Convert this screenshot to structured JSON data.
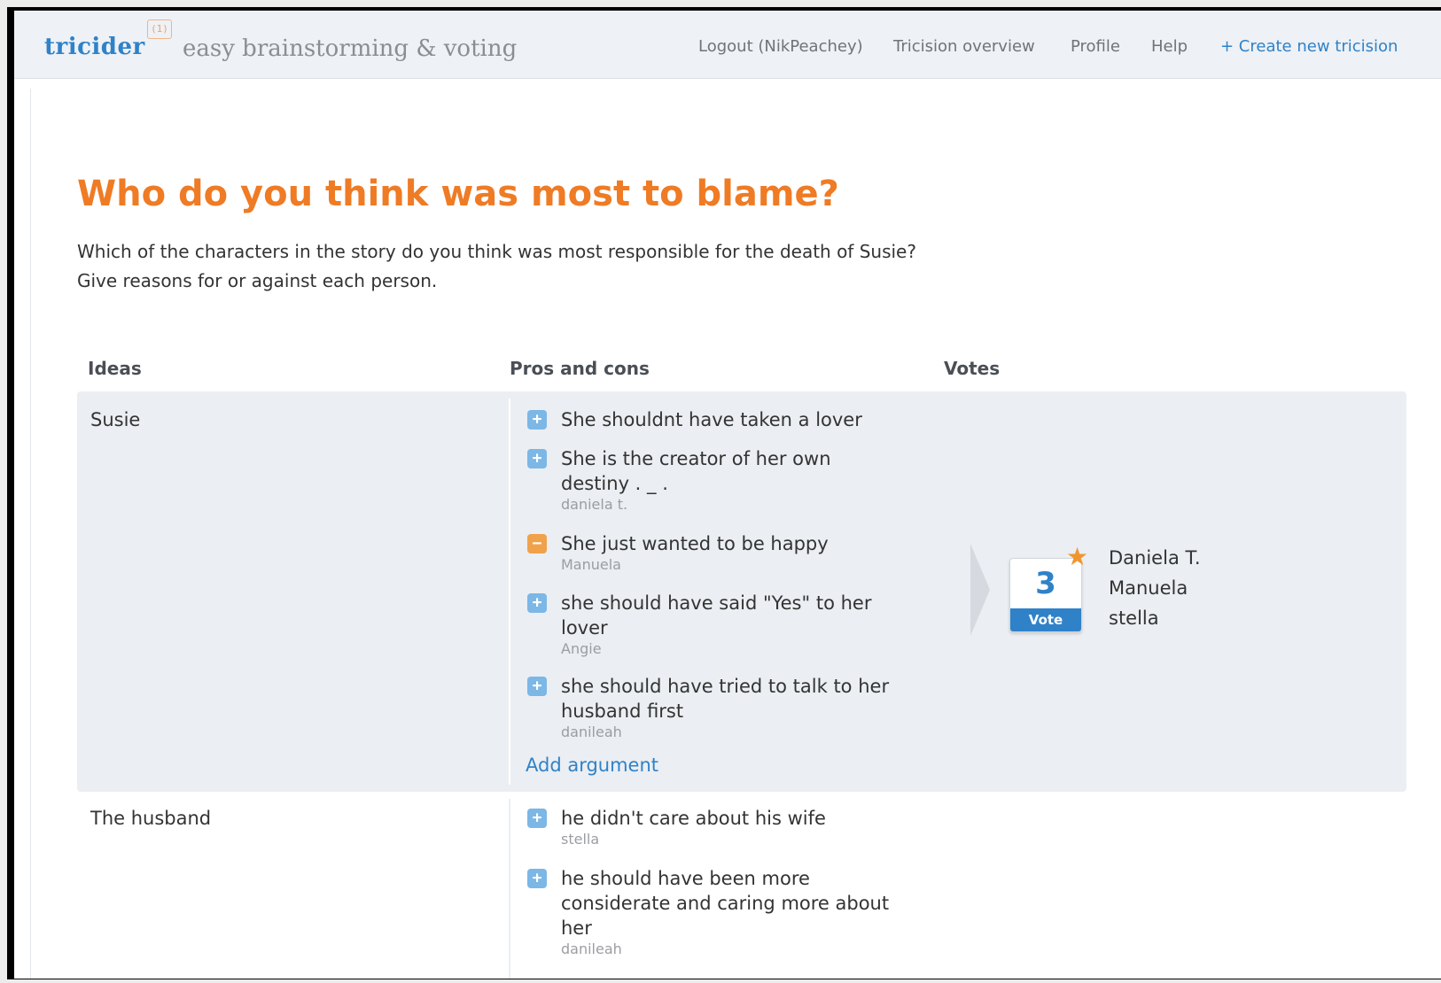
{
  "header": {
    "logo": "tricider",
    "logo_badge": "(1)",
    "tagline": "easy brainstorming & voting",
    "nav": {
      "logout": "Logout (NikPeachey)",
      "overview": "Tricision overview",
      "profile": "Profile",
      "help": "Help",
      "create": "+ Create new tricision"
    }
  },
  "question": {
    "title": "Who do you think was most to blame?",
    "description_line1": "Which of the characters in the story do you think was most responsible for the death of Susie?",
    "description_line2": "Give reasons for or against each person."
  },
  "columns": {
    "ideas": "Ideas",
    "pros_cons": "Pros and cons",
    "votes": "Votes"
  },
  "ideas": [
    {
      "name": "Susie",
      "arguments": [
        {
          "type": "pro",
          "text": "She shouldnt have taken a lover",
          "author": ""
        },
        {
          "type": "pro",
          "text": "She is the creator of her own destiny  . _ .",
          "author": "daniela t."
        },
        {
          "type": "con",
          "text": "She just wanted to be happy",
          "author": "Manuela"
        },
        {
          "type": "pro",
          "text": "she should have said \"Yes\" to her lover",
          "author": "Angie"
        },
        {
          "type": "pro",
          "text": "she should have tried to talk to her husband first",
          "author": "danileah"
        }
      ],
      "add_argument": "Add argument",
      "vote_count": "3",
      "vote_label": "Vote",
      "voters": [
        "Daniela T.",
        "Manuela",
        "stella"
      ]
    },
    {
      "name": "The husband",
      "arguments": [
        {
          "type": "pro",
          "text": "he didn't care about his wife",
          "author": "stella"
        },
        {
          "type": "pro",
          "text": "he should have been more considerate and caring more about her",
          "author": "danileah"
        }
      ]
    }
  ],
  "icons": {
    "pro": "plus-icon",
    "con": "minus-icon",
    "star": "star-icon"
  },
  "colors": {
    "brand_blue": "#2f82c8",
    "title_orange": "#ef7b25",
    "row_bg": "#ebeef2",
    "pro_icon": "#7cb7e6",
    "con_icon": "#f0a24a"
  }
}
